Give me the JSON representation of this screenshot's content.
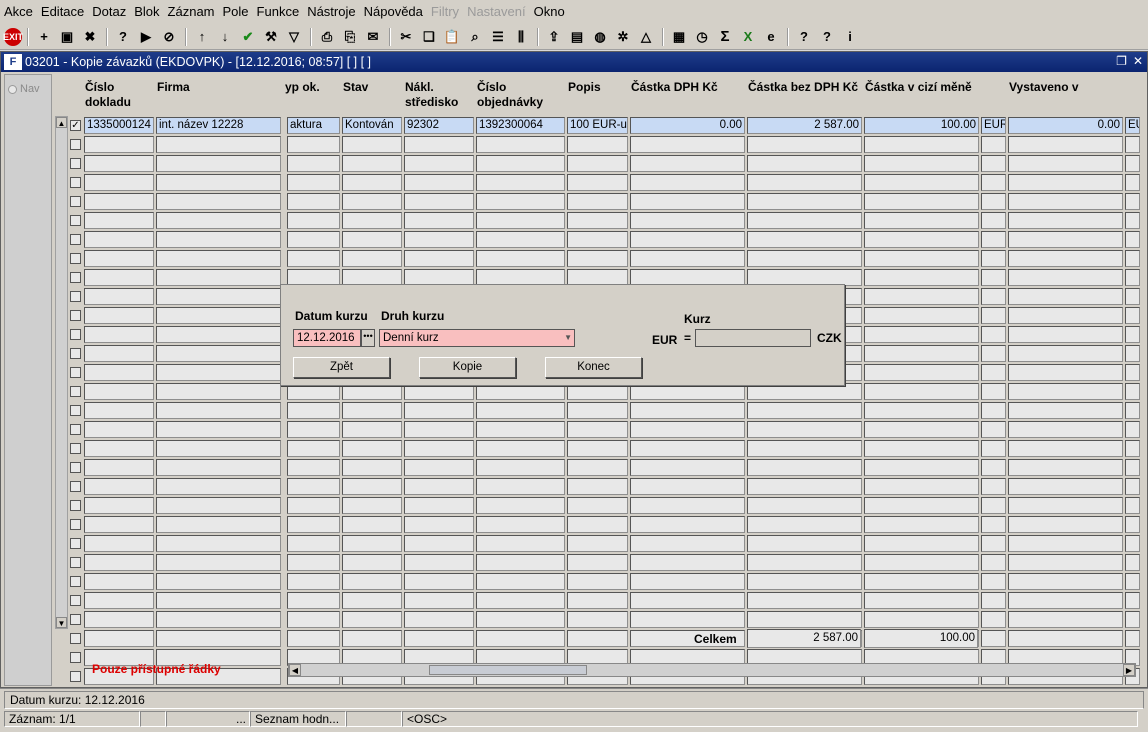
{
  "menu": [
    "Akce",
    "Editace",
    "Dotaz",
    "Blok",
    "Záznam",
    "Pole",
    "Funkce",
    "Nástroje",
    "Nápověda",
    "Filtry",
    "Nastavení",
    "Okno"
  ],
  "menu_disabled": [
    "Filtry",
    "Nastavení"
  ],
  "window": {
    "title": "03201 - Kopie závazků (EKDOVPK) - [12.12.2016; 08:57]  [ ]  [ ]"
  },
  "nav": {
    "label": "Nav"
  },
  "columns": [
    {
      "label": "Číslo dokladu"
    },
    {
      "label": "Firma"
    },
    {
      "label": "yp ok."
    },
    {
      "label": "Stav"
    },
    {
      "label": "Nákl. středisko"
    },
    {
      "label": "Číslo objednávky"
    },
    {
      "label": "Popis"
    },
    {
      "label": "Částka DPH Kč"
    },
    {
      "label": "Částka bez DPH Kč"
    },
    {
      "label": "Částka v cizí měně"
    },
    {
      "label": ""
    },
    {
      "label": "Vystaveno v"
    },
    {
      "label": ""
    }
  ],
  "rows": [
    [
      "1335000124",
      "int. název 12228",
      "aktura",
      "Kontován",
      "92302",
      "1392300064",
      "100 EUR-ub",
      "0.00",
      "2 587.00",
      "100.00",
      "EUR",
      "0.00",
      "EU"
    ]
  ],
  "empty_rows": 29,
  "totals": {
    "label": "Celkem",
    "without_vat": "2 587.00",
    "foreign": "100.00"
  },
  "note": "Pouze přístupné řádky",
  "dialog": {
    "datum_label": "Datum kurzu",
    "datum_value": "12.12.2016",
    "druh_label": "Druh kurzu",
    "druh_value": "Denní kurz",
    "kurz_label": "Kurz",
    "currency_from": "EUR",
    "equals": "=",
    "kurz_value": "",
    "currency_to": "CZK",
    "btn_back": "Zpět",
    "btn_copy": "Kopie",
    "btn_end": "Konec"
  },
  "status": {
    "message": "Datum kurzu: 12.12.2016",
    "record": "Záznam: 1/1",
    "dots": "...",
    "list": "Seznam hodn...",
    "osc": "<OSC>"
  },
  "toolbar_icons": [
    "exit-icon",
    "insert-record-icon",
    "save-icon",
    "delete-record-icon",
    "query-icon",
    "execute-query-icon",
    "cancel-query-icon",
    "sort-asc-icon",
    "sort-desc-icon",
    "checkmark-icon",
    "wrench-icon",
    "filter-icon",
    "print-icon",
    "print-preview-icon",
    "mail-icon",
    "cut-icon",
    "copy-icon",
    "paste-icon",
    "find-icon",
    "list-icon",
    "columns-icon",
    "export-icon",
    "document-icon",
    "globe-icon",
    "ship-wheel-icon",
    "triangle-icon",
    "chart-icon",
    "clock-icon",
    "sum-icon",
    "excel-icon",
    "internet-explorer-icon",
    "help-icon",
    "whats-this-icon",
    "info-icon"
  ]
}
